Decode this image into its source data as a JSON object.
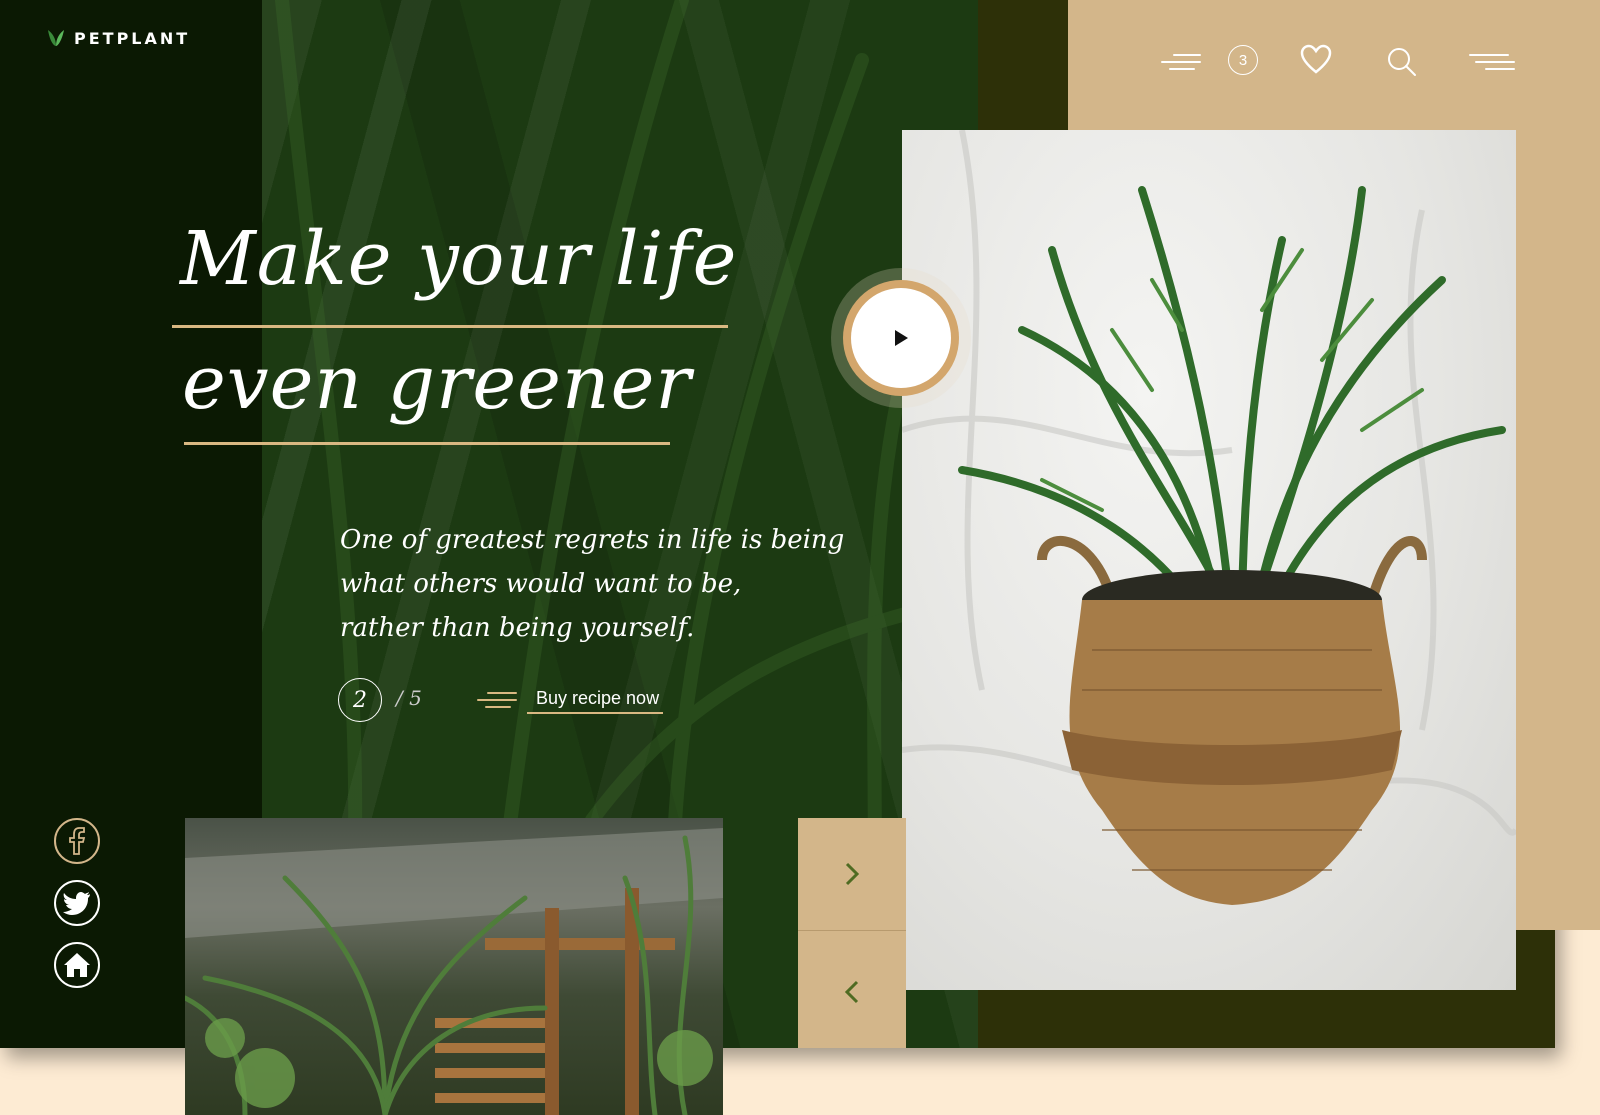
{
  "brand": {
    "name": "PETPLANT"
  },
  "topnav": {
    "cart_count": "3",
    "icons": [
      "filter-lines-icon",
      "cart-count-badge",
      "heart-icon",
      "search-icon",
      "menu-icon"
    ]
  },
  "hero": {
    "title_line1": "Make your life",
    "title_line2": "even greener",
    "quote_line1": "One of greatest regrets in life is being",
    "quote_line2": "what others would want to be,",
    "quote_line3": "rather than being yourself.",
    "current_page": "2",
    "total_pages": "/ 5",
    "cta_label": "Buy recipe now"
  },
  "social": [
    "facebook-icon",
    "twitter-icon",
    "home-icon"
  ],
  "colors": {
    "dark_green": "#0b1903",
    "hero_green": "#1c3a12",
    "olive": "#2d3008",
    "tan": "#d3b68a",
    "gold_line": "#d9b882",
    "cream_bg": "#fdebd3",
    "arrow_green": "#4f6b22"
  }
}
